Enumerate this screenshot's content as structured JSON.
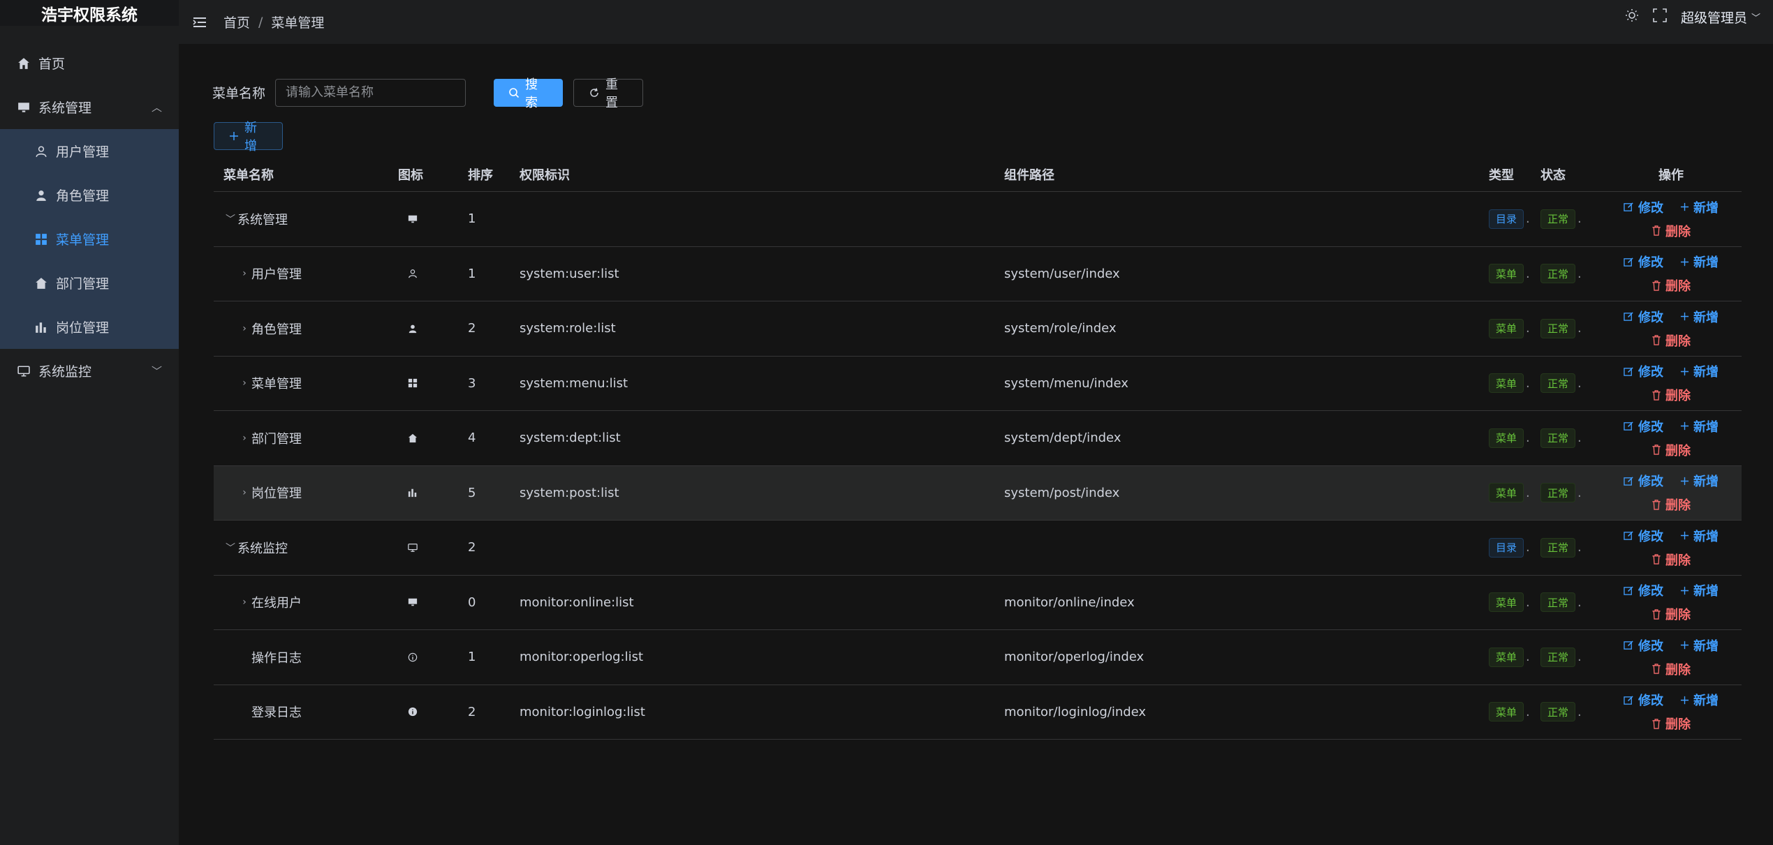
{
  "app": {
    "title": "浩宇权限系统"
  },
  "sidebar": {
    "home": "首页",
    "system_group": "系统管理",
    "system_items": [
      "用户管理",
      "角色管理",
      "菜单管理",
      "部门管理",
      "岗位管理"
    ],
    "active_item": "菜单管理",
    "monitor_group": "系统监控"
  },
  "header": {
    "breadcrumb": [
      "首页",
      "菜单管理"
    ],
    "user": "超级管理员"
  },
  "search": {
    "label": "菜单名称",
    "placeholder": "请输入菜单名称",
    "search_button": "搜索",
    "reset_button": "重置",
    "add_button": "新增"
  },
  "table": {
    "columns": [
      "菜单名称",
      "图标",
      "排序",
      "权限标识",
      "组件路径",
      "类型",
      "状态",
      "操作"
    ],
    "rows": [
      {
        "name": "系统管理",
        "icon": "monitor-icon",
        "order": "1",
        "perm": "",
        "path": "",
        "type": "目录",
        "status": "正常",
        "expand": "open",
        "indent": 0
      },
      {
        "name": "用户管理",
        "icon": "user-icon",
        "order": "1",
        "perm": "system:user:list",
        "path": "system/user/index",
        "type": "菜单",
        "status": "正常",
        "expand": "closed",
        "indent": 1
      },
      {
        "name": "角色管理",
        "icon": "user-filled-icon",
        "order": "2",
        "perm": "system:role:list",
        "path": "system/role/index",
        "type": "菜单",
        "status": "正常",
        "expand": "closed",
        "indent": 1
      },
      {
        "name": "菜单管理",
        "icon": "grid-icon",
        "order": "3",
        "perm": "system:menu:list",
        "path": "system/menu/index",
        "type": "菜单",
        "status": "正常",
        "expand": "closed",
        "indent": 1
      },
      {
        "name": "部门管理",
        "icon": "house-icon",
        "order": "4",
        "perm": "system:dept:list",
        "path": "system/dept/index",
        "type": "菜单",
        "status": "正常",
        "expand": "closed",
        "indent": 1
      },
      {
        "name": "岗位管理",
        "icon": "bar-chart-icon",
        "order": "5",
        "perm": "system:post:list",
        "path": "system/post/index",
        "type": "菜单",
        "status": "正常",
        "expand": "closed",
        "indent": 1
      },
      {
        "name": "系统监控",
        "icon": "screen-icon",
        "order": "2",
        "perm": "",
        "path": "",
        "type": "目录",
        "status": "正常",
        "expand": "open",
        "indent": 0
      },
      {
        "name": "在线用户",
        "icon": "monitor-icon",
        "order": "0",
        "perm": "monitor:online:list",
        "path": "monitor/online/index",
        "type": "菜单",
        "status": "正常",
        "expand": "closed",
        "indent": 1
      },
      {
        "name": "操作日志",
        "icon": "info-icon",
        "order": "1",
        "perm": "monitor:operlog:list",
        "path": "monitor/operlog/index",
        "type": "菜单",
        "status": "正常",
        "expand": "none",
        "indent": 1
      },
      {
        "name": "登录日志",
        "icon": "info-filled-icon",
        "order": "2",
        "perm": "monitor:loginlog:list",
        "path": "monitor/loginlog/index",
        "type": "菜单",
        "status": "正常",
        "expand": "none",
        "indent": 1
      }
    ],
    "ops": {
      "edit": "修改",
      "add": "新增",
      "delete": "删除"
    }
  },
  "colors": {
    "primary": "#409eff",
    "success": "#67c23a",
    "danger": "#f56c6c",
    "sidebar_submenu": "#2b3a4f"
  }
}
